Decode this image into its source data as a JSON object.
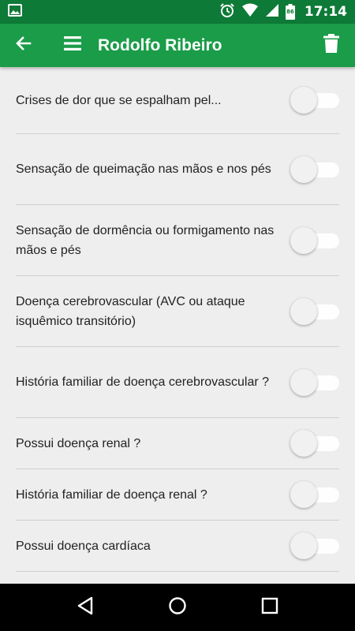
{
  "status_bar": {
    "time": "17:14",
    "battery_level": "86",
    "icons": [
      "image-icon",
      "alarm-icon",
      "wifi-icon",
      "signal-icon",
      "battery-icon"
    ]
  },
  "app_bar": {
    "title": "Rodolfo Ribeiro",
    "icons": [
      "back-arrow-icon",
      "menu-icon",
      "trash-icon"
    ]
  },
  "colors": {
    "status_bar": "#0e7a37",
    "app_bar": "#1a9c48",
    "background": "#eeeeee",
    "divider": "#cfcfcf"
  },
  "items": [
    {
      "label": "Crises de dor que se espalham pel...",
      "checked": false
    },
    {
      "label": "Sensação de queimação nas mãos e nos pés",
      "checked": false
    },
    {
      "label": "Sensação de dormência ou formigamento nas mãos e pés",
      "checked": false
    },
    {
      "label": "Doença cerebrovascular (AVC ou ataque isquêmico transitório)",
      "checked": false
    },
    {
      "label": "História familiar de doença cerebrovascular ?",
      "checked": false
    },
    {
      "label": "Possui doença renal ?",
      "checked": false
    },
    {
      "label": "História familiar de doença renal ?",
      "checked": false
    },
    {
      "label": "Possui doença cardíaca",
      "checked": false
    }
  ],
  "nav_bar": {
    "icons": [
      "nav-back-icon",
      "nav-home-icon",
      "nav-recents-icon"
    ]
  }
}
